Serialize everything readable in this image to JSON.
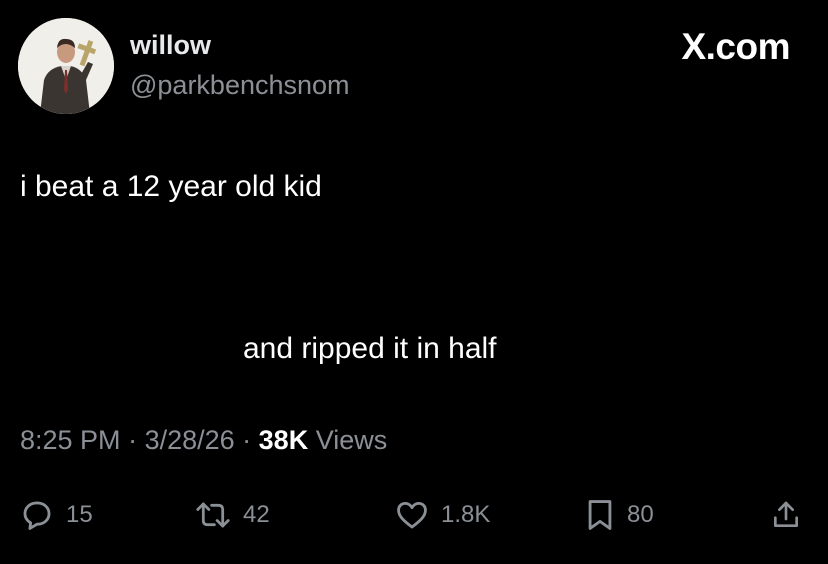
{
  "user": {
    "display_name": "willow",
    "handle": "@parkbenchsnom",
    "avatar_icon": "profile-photo"
  },
  "brand": {
    "label": "X.com"
  },
  "tweet": {
    "line1": "i beat a 12 year old kid",
    "line2": "and ripped it in half"
  },
  "meta": {
    "time": "8:25 PM",
    "sep1": " · ",
    "date": "3/28/26",
    "sep2": " · ",
    "views_count": "38K",
    "views_label": " Views"
  },
  "actions": {
    "reply": {
      "icon": "reply-icon",
      "count": "15"
    },
    "repost": {
      "icon": "repost-icon",
      "count": "42"
    },
    "like": {
      "icon": "heart-icon",
      "count": "1.8K"
    },
    "bookmark": {
      "icon": "bookmark-icon",
      "count": "80"
    },
    "share": {
      "icon": "share-icon"
    }
  },
  "colors": {
    "background": "#000000",
    "primary_text": "#ffffff",
    "secondary_text": "#8b9096"
  }
}
